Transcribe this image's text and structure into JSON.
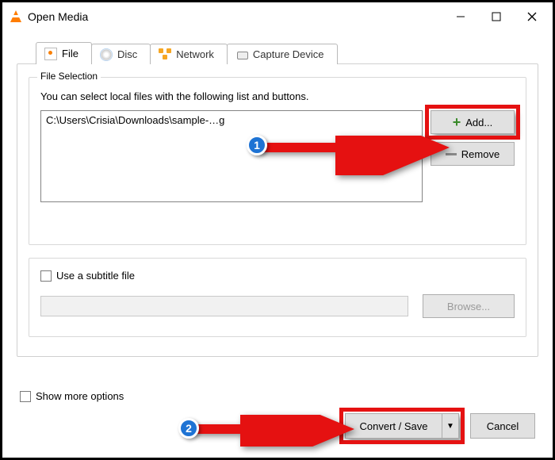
{
  "window": {
    "title": "Open Media"
  },
  "tabs": {
    "file": "File",
    "disc": "Disc",
    "network": "Network",
    "capture": "Capture Device"
  },
  "file_selection": {
    "group_title": "File Selection",
    "help": "You can select local files with the following list and buttons.",
    "items": [
      "C:\\Users\\Crisia\\Downloads\\sample-…g"
    ],
    "add_label": "Add...",
    "remove_label": "Remove"
  },
  "subtitle": {
    "use_label": "Use a subtitle file",
    "browse_label": "Browse..."
  },
  "show_more_label": "Show more options",
  "bottom": {
    "convert_label": "Convert / Save",
    "cancel_label": "Cancel"
  },
  "annotations": {
    "badge1": "1",
    "badge2": "2"
  }
}
